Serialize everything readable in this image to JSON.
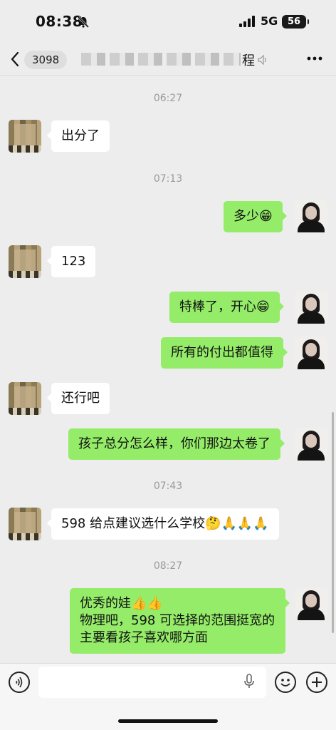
{
  "status_bar": {
    "time": "08:38",
    "network": "5G",
    "battery": "56"
  },
  "nav": {
    "unread_count": "3098",
    "title_visible_tail": "程"
  },
  "messages": [
    {
      "type": "time",
      "text": "06:27"
    },
    {
      "type": "received",
      "text": "出分了"
    },
    {
      "type": "time",
      "text": "07:13"
    },
    {
      "type": "sent",
      "text": "多少😁"
    },
    {
      "type": "received",
      "text": "123"
    },
    {
      "type": "sent",
      "text": "特棒了，开心😁"
    },
    {
      "type": "sent",
      "text": "所有的付出都值得"
    },
    {
      "type": "received",
      "text": "还行吧"
    },
    {
      "type": "sent",
      "text": "孩子总分怎么样，你们那边太卷了"
    },
    {
      "type": "time",
      "text": "07:43"
    },
    {
      "type": "received",
      "text": "598 给点建议选什么学校🤔🙏🙏🙏"
    },
    {
      "type": "time",
      "text": "08:27"
    },
    {
      "type": "sent",
      "lines": [
        "优秀的娃👍👍",
        "物理吧，598 可选择的范围挺宽的",
        "主要看孩子喜欢哪方面"
      ]
    }
  ],
  "input": {
    "placeholder": ""
  },
  "icons": {
    "back": "chevron-left-icon",
    "mute": "mute-icon",
    "more": "more-icon",
    "voice": "voice-icon",
    "mic": "mic-icon",
    "emoji": "emoji-icon",
    "plus": "plus-icon"
  },
  "colors": {
    "sent_bubble": "#95ec69",
    "received_bubble": "#ffffff",
    "background": "#ededed"
  }
}
